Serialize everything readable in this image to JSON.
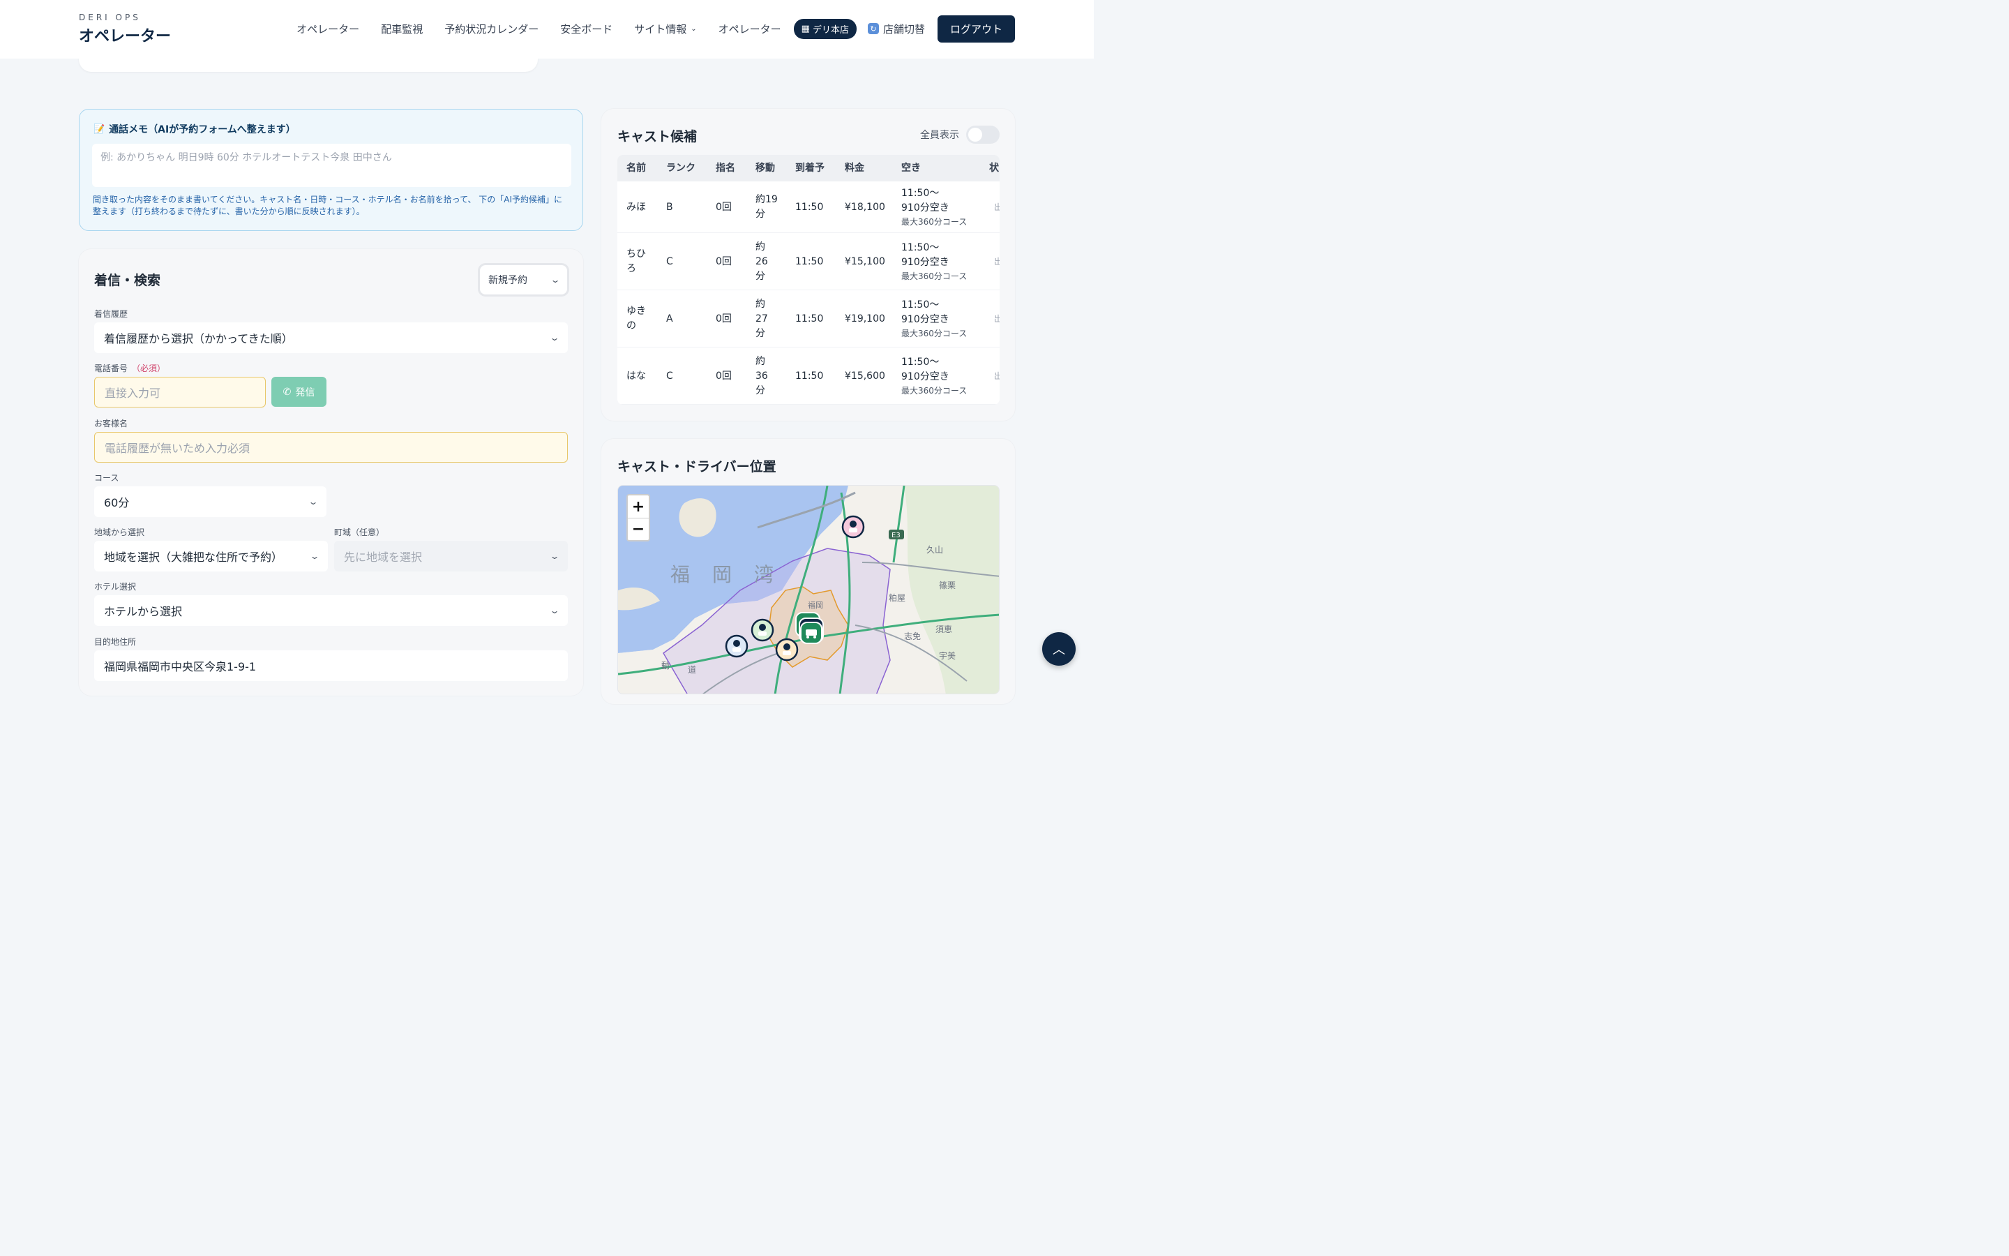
{
  "header": {
    "brand_sub": "DERI OPS",
    "brand_title": "オペレーター",
    "nav": [
      "オペレーター",
      "配車監視",
      "予約状況カレンダー",
      "安全ボード",
      "サイト情報",
      "オペレーター"
    ],
    "store_pill": "デリ本店",
    "switch_store": "店舗切替",
    "logout": "ログアウト"
  },
  "memo": {
    "title": "通話メモ（AIが予約フォームへ整えます）",
    "placeholder": "例: あかりちゃん 明日9時 60分 ホテルオートテスト今泉 田中さん",
    "help": "聞き取った内容をそのまま書いてください。キャスト名・日時・コース・ホテル名・お名前を拾って、 下の「AI予約候補」に整えます（打ち終わるまで待たずに、書いた分から順に反映されます）。"
  },
  "form": {
    "title": "着信・検索",
    "mode": "新規予約",
    "history_label": "着信履歴",
    "history_value": "着信履歴から選択（かかってきた順）",
    "phone_label": "電話番号",
    "phone_required": "（必須）",
    "phone_placeholder": "直接入力可",
    "call_button": "発信",
    "customer_label": "お客様名",
    "customer_placeholder": "電話履歴が無いため入力必須",
    "course_label": "コース",
    "course_value": "60分",
    "area_label": "地域から選択",
    "area_value": "地域を選択（大雑把な住所で予約）",
    "town_label": "町域（任意）",
    "town_value": "先に地域を選択",
    "hotel_label": "ホテル選択",
    "hotel_value": "ホテルから選択",
    "address_label": "目的地住所",
    "address_value": "福岡県福岡市中央区今泉1-9-1"
  },
  "cast": {
    "title": "キャスト候補",
    "show_all": "全員表示",
    "columns": [
      "名前",
      "ランク",
      "指名",
      "移動",
      "到着予",
      "料金",
      "空き",
      "状"
    ],
    "rows": [
      {
        "name": [
          "みほ"
        ],
        "rank": "B",
        "nominated": "0回",
        "move": [
          "約19",
          "分"
        ],
        "arrival": "11:50",
        "fee": "¥18,100",
        "free1": "11:50〜",
        "free2": "910分空き",
        "course": "最大360分コース",
        "status": "出"
      },
      {
        "name": [
          "ちひ",
          "ろ"
        ],
        "rank": "C",
        "nominated": "0回",
        "move": [
          "約",
          "26",
          "分"
        ],
        "arrival": "11:50",
        "fee": "¥15,100",
        "free1": "11:50〜",
        "free2": "910分空き",
        "course": "最大360分コース",
        "status": "出"
      },
      {
        "name": [
          "ゆき",
          "の"
        ],
        "rank": "A",
        "nominated": "0回",
        "move": [
          "約",
          "27",
          "分"
        ],
        "arrival": "11:50",
        "fee": "¥19,100",
        "free1": "11:50〜",
        "free2": "910分空き",
        "course": "最大360分コース",
        "status": "出"
      },
      {
        "name": [
          "はな"
        ],
        "rank": "C",
        "nominated": "0回",
        "move": [
          "約",
          "36",
          "分"
        ],
        "arrival": "11:50",
        "fee": "¥15,600",
        "free1": "11:50〜",
        "free2": "910分空き",
        "course": "最大360分コース",
        "status": "出"
      }
    ]
  },
  "map": {
    "title": "キャスト・ドライバー位置",
    "zoom_in": "+",
    "zoom_out": "−",
    "labels": [
      "福",
      "岡",
      "湾",
      "E3",
      "久山",
      "篠栗",
      "粕屋",
      "志免",
      "須恵",
      "宇美",
      "福岡",
      "動",
      "道"
    ]
  },
  "colors": {
    "navy": "#0f2744",
    "accent_green": "#7ecdb2",
    "required": "#d0436b"
  }
}
